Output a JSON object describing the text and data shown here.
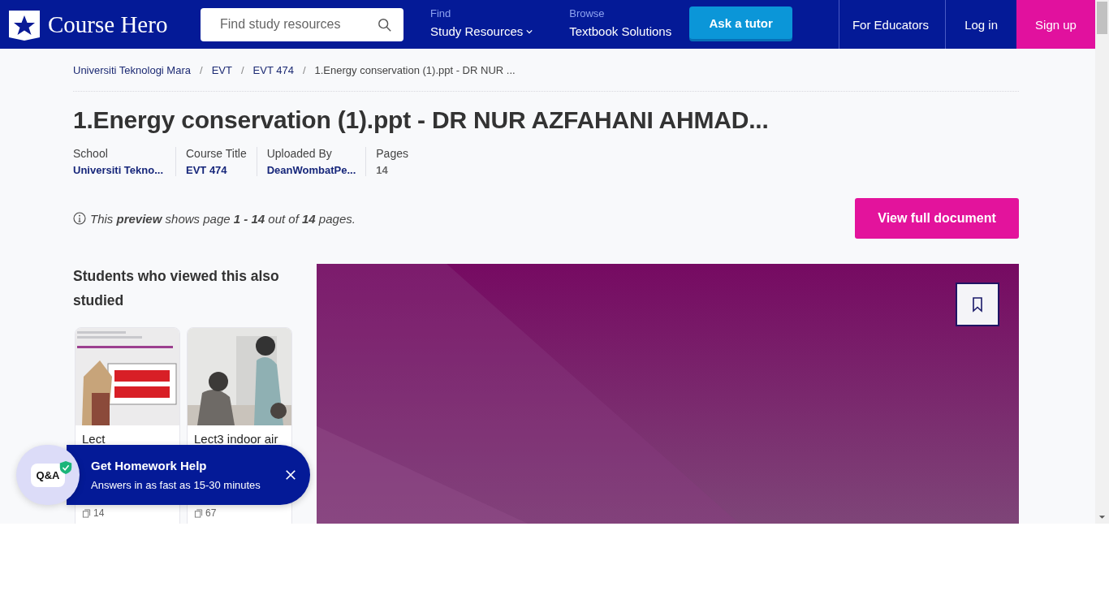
{
  "header": {
    "logo_text": "Course Hero",
    "search": {
      "placeholder": "Find study resources"
    },
    "nav": [
      {
        "top": "Find",
        "label": "Study Resources",
        "dropdown": true
      },
      {
        "top": "Browse",
        "label": "Textbook Solutions",
        "dropdown": false
      }
    ],
    "ask_button": "Ask a tutor",
    "links": [
      "For Educators",
      "Log in"
    ],
    "signup": "Sign up"
  },
  "breadcrumb": [
    {
      "label": "Universiti Teknologi Mara",
      "current": false
    },
    {
      "separator": "/",
      "label": "EVT",
      "current": false
    },
    {
      "separator": "/",
      "label": "EVT 474",
      "current": false
    },
    {
      "separator": "/",
      "label": "1.Energy conservation (1).ppt - DR NUR ...",
      "current": true
    }
  ],
  "title": "1.Energy conservation (1).ppt - DR NUR AZFAHANI AHMAD...",
  "meta": [
    {
      "label": "School",
      "value": "Universiti Tekno...",
      "kind": "link"
    },
    {
      "label": "Course Title",
      "value": "EVT 474",
      "kind": "link"
    },
    {
      "label": "Uploaded By",
      "value": "DeanWombatPe...",
      "kind": "link"
    },
    {
      "label": "Pages",
      "value": "14",
      "kind": "plain"
    }
  ],
  "preview_note": "This **preview** shows page **1 - 14** out of **14** pages.",
  "view_button": "View full document",
  "related": {
    "heading": "Students who viewed this also studied",
    "cards": [
      {
        "title": "Lect",
        "pages": "14",
        "kind": "slide"
      },
      {
        "title": "Lect3 indoor air",
        "pages": "67"
      }
    ]
  },
  "popup": {
    "badge": "Q&A",
    "verified": true,
    "title": "Get Homework Help",
    "subtitle": "Answers in as fast as 15-30 minutes"
  }
}
